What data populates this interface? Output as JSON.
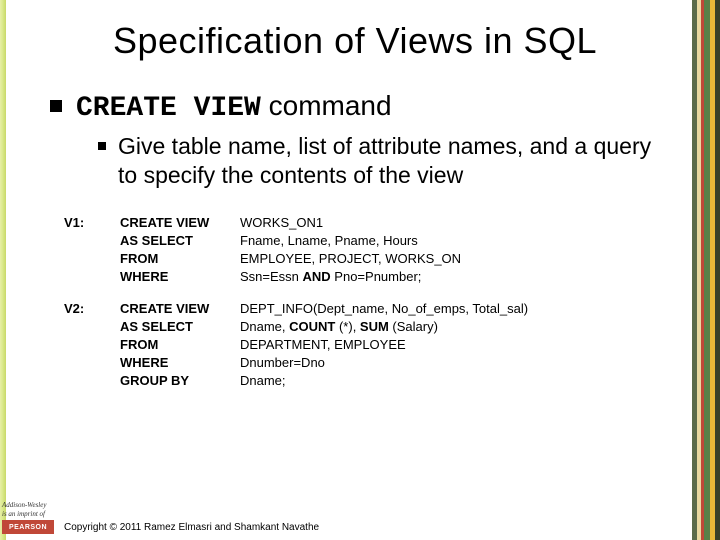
{
  "title": "Specification of Views in SQL",
  "bullet1": {
    "code": "CREATE VIEW",
    "rest": " command"
  },
  "bullet2": "Give table name, list of attribute names, and a query to specify the contents of the view",
  "sql": {
    "v1": {
      "label": "V1:",
      "rows": [
        {
          "kw": "CREATE VIEW",
          "val": "WORKS_ON1"
        },
        {
          "kw": "AS SELECT",
          "val": "Fname, Lname, Pname, Hours"
        },
        {
          "kw": "FROM",
          "val": "EMPLOYEE, PROJECT, WORKS_ON"
        },
        {
          "kw": "WHERE",
          "val_parts": [
            "Ssn=Essn ",
            "AND",
            " Pno=Pnumber;"
          ]
        }
      ]
    },
    "v2": {
      "label": "V2:",
      "rows": [
        {
          "kw": "CREATE VIEW",
          "val": "DEPT_INFO(Dept_name, No_of_emps, Total_sal)"
        },
        {
          "kw": "AS SELECT",
          "val_parts": [
            "Dname, ",
            "COUNT",
            " (*), ",
            "SUM",
            " (Salary)"
          ]
        },
        {
          "kw": "FROM",
          "val": "DEPARTMENT, EMPLOYEE"
        },
        {
          "kw": "WHERE",
          "val": "Dnumber=Dno"
        },
        {
          "kw": "GROUP BY",
          "val": "Dname;"
        }
      ]
    }
  },
  "footer": {
    "addison": "Addison-Wesley",
    "imprint": "is an imprint of",
    "pearson": "PEARSON",
    "copyright": "Copyright © 2011 Ramez Elmasri and Shamkant Navathe"
  }
}
